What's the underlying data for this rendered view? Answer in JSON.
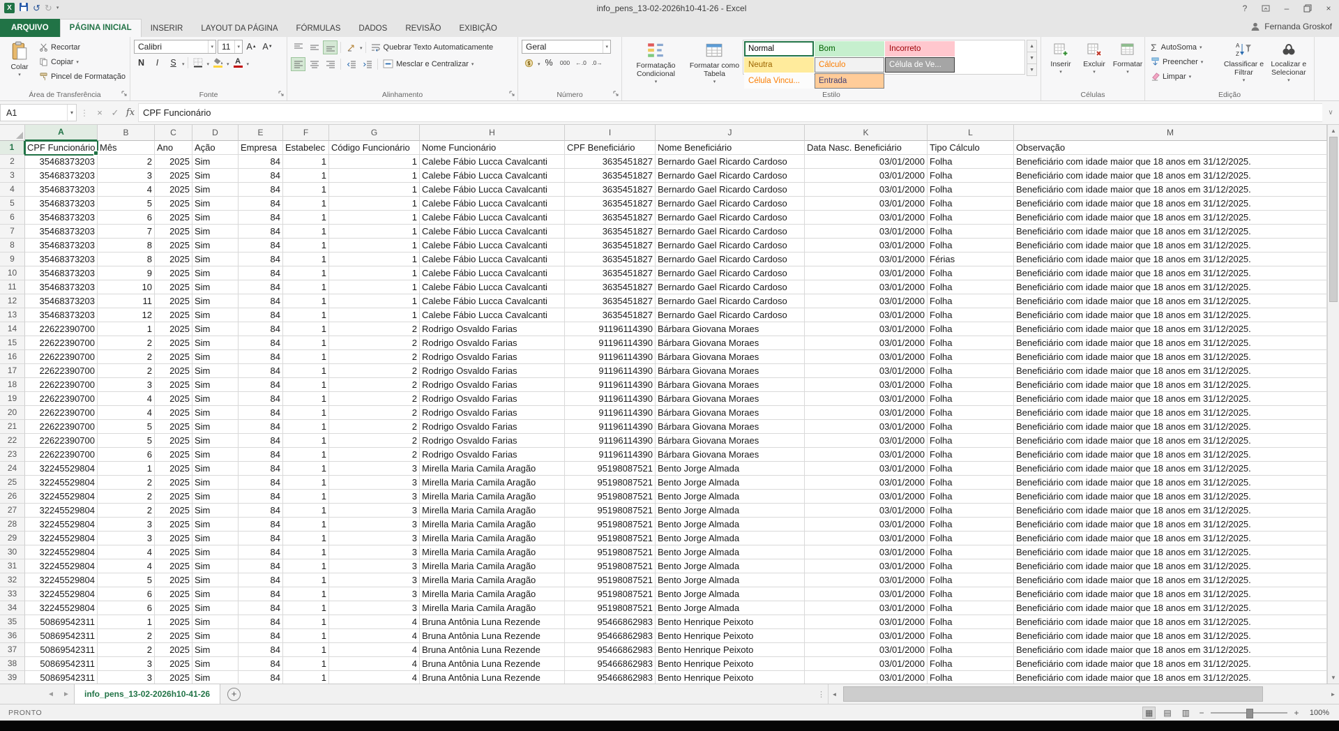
{
  "window": {
    "title": "info_pens_13-02-2026h10-41-26 - Excel",
    "user": "Fernanda Groskof",
    "accent": "#217346"
  },
  "icons": {
    "app": "X",
    "undo": "↺",
    "redo": "↻",
    "qat_caret": "▾",
    "help": "?",
    "minimize": "–",
    "close": "×",
    "cancel": "×",
    "enter": "✓",
    "fx": "fx",
    "formula_expand": "∨",
    "autosum": "Σ",
    "percent": "%",
    "thousands": "000",
    "increase_decimal": "←.0",
    "decrease_decimal": ".0→",
    "bold": "N",
    "italic": "I",
    "underline": "S",
    "sheet_prev": "◄",
    "sheet_next": "►",
    "new_sheet": "+",
    "splitter": "⋮",
    "scroll_left": "◄",
    "scroll_right": "►",
    "scroll_up": "▲",
    "scroll_down": "▼",
    "view_normal": "▦",
    "view_layout": "▤",
    "view_break": "▥",
    "zoom_out": "−",
    "zoom_in": "+"
  },
  "ribbon": {
    "tabs": [
      {
        "label": "ARQUIVO",
        "file": true
      },
      {
        "label": "PÁGINA INICIAL",
        "active": true
      },
      {
        "label": "INSERIR"
      },
      {
        "label": "LAYOUT DA PÁGINA"
      },
      {
        "label": "FÓRMULAS"
      },
      {
        "label": "DADOS"
      },
      {
        "label": "REVISÃO"
      },
      {
        "label": "EXIBIÇÃO"
      }
    ],
    "clipboard": {
      "label": "Área de Transferência",
      "paste": "Colar",
      "cut": "Recortar",
      "copy": "Copiar",
      "painter": "Pincel de Formatação"
    },
    "font": {
      "label": "Fonte",
      "family": "Calibri",
      "size": "11"
    },
    "alignment": {
      "label": "Alinhamento",
      "wrap": "Quebrar Texto Automaticamente",
      "merge": "Mesclar e Centralizar"
    },
    "number": {
      "label": "Número",
      "format": "Geral"
    },
    "styles": {
      "label": "Estilo",
      "conditional": "Formatação Condicional",
      "format_table": "Formatar como Tabela",
      "gallery": [
        {
          "label": "Normal",
          "bg": "#ffffff",
          "fg": "#000000",
          "selected": true
        },
        {
          "label": "Bom",
          "bg": "#c6efce",
          "fg": "#006100"
        },
        {
          "label": "Incorreto",
          "bg": "#ffc7ce",
          "fg": "#9c0006"
        },
        {
          "label": "Neutra",
          "bg": "#ffeb9c",
          "fg": "#9c6500"
        },
        {
          "label": "Cálculo",
          "bg": "#f2f2f2",
          "fg": "#fa7d00",
          "border": "#7f7f7f"
        },
        {
          "label": "Célula de Ve...",
          "bg": "#a5a5a5",
          "fg": "#ffffff",
          "border": "#3f3f3f"
        },
        {
          "label": "Célula Vincu...",
          "bg": "#fcfcfc",
          "fg": "#fa7d00"
        },
        {
          "label": "Entrada",
          "bg": "#ffcc99",
          "fg": "#3f3f76",
          "border": "#7f7f7f"
        }
      ]
    },
    "cells": {
      "label": "Células",
      "insert": "Inserir",
      "delete": "Excluir",
      "format": "Formatar"
    },
    "editing": {
      "label": "Edição",
      "autosum": "AutoSoma",
      "fill": "Preencher",
      "clear": "Limpar",
      "sort": "Classificar e Filtrar",
      "find": "Localizar e Selecionar"
    }
  },
  "formula": {
    "cell_ref": "A1",
    "content": "CPF Funcionário"
  },
  "sheet": {
    "tab_name": "info_pens_13-02-2026h10-41-26",
    "columns": [
      "A",
      "B",
      "C",
      "D",
      "E",
      "F",
      "G",
      "H",
      "I",
      "J",
      "K",
      "L",
      "M"
    ],
    "rows": [
      [
        "CPF Funcionário",
        "Mês",
        "Ano",
        "Ação",
        "Empresa",
        "Estabelec",
        "Código Funcionário",
        "Nome Funcionário",
        "CPF Beneficiário",
        "Nome Beneficiário",
        "Data Nasc. Beneficiário",
        "Tipo Cálculo",
        "Observação"
      ],
      [
        "35468373203",
        "2",
        "2025",
        "Sim",
        "84",
        "1",
        "1",
        "Calebe Fábio Lucca Cavalcanti",
        "3635451827",
        "Bernardo Gael Ricardo Cardoso",
        "03/01/2000",
        "Folha",
        "Beneficiário com idade maior que 18 anos em 31/12/2025."
      ],
      [
        "35468373203",
        "3",
        "2025",
        "Sim",
        "84",
        "1",
        "1",
        "Calebe Fábio Lucca Cavalcanti",
        "3635451827",
        "Bernardo Gael Ricardo Cardoso",
        "03/01/2000",
        "Folha",
        "Beneficiário com idade maior que 18 anos em 31/12/2025."
      ],
      [
        "35468373203",
        "4",
        "2025",
        "Sim",
        "84",
        "1",
        "1",
        "Calebe Fábio Lucca Cavalcanti",
        "3635451827",
        "Bernardo Gael Ricardo Cardoso",
        "03/01/2000",
        "Folha",
        "Beneficiário com idade maior que 18 anos em 31/12/2025."
      ],
      [
        "35468373203",
        "5",
        "2025",
        "Sim",
        "84",
        "1",
        "1",
        "Calebe Fábio Lucca Cavalcanti",
        "3635451827",
        "Bernardo Gael Ricardo Cardoso",
        "03/01/2000",
        "Folha",
        "Beneficiário com idade maior que 18 anos em 31/12/2025."
      ],
      [
        "35468373203",
        "6",
        "2025",
        "Sim",
        "84",
        "1",
        "1",
        "Calebe Fábio Lucca Cavalcanti",
        "3635451827",
        "Bernardo Gael Ricardo Cardoso",
        "03/01/2000",
        "Folha",
        "Beneficiário com idade maior que 18 anos em 31/12/2025."
      ],
      [
        "35468373203",
        "7",
        "2025",
        "Sim",
        "84",
        "1",
        "1",
        "Calebe Fábio Lucca Cavalcanti",
        "3635451827",
        "Bernardo Gael Ricardo Cardoso",
        "03/01/2000",
        "Folha",
        "Beneficiário com idade maior que 18 anos em 31/12/2025."
      ],
      [
        "35468373203",
        "8",
        "2025",
        "Sim",
        "84",
        "1",
        "1",
        "Calebe Fábio Lucca Cavalcanti",
        "3635451827",
        "Bernardo Gael Ricardo Cardoso",
        "03/01/2000",
        "Folha",
        "Beneficiário com idade maior que 18 anos em 31/12/2025."
      ],
      [
        "35468373203",
        "8",
        "2025",
        "Sim",
        "84",
        "1",
        "1",
        "Calebe Fábio Lucca Cavalcanti",
        "3635451827",
        "Bernardo Gael Ricardo Cardoso",
        "03/01/2000",
        "Férias",
        "Beneficiário com idade maior que 18 anos em 31/12/2025."
      ],
      [
        "35468373203",
        "9",
        "2025",
        "Sim",
        "84",
        "1",
        "1",
        "Calebe Fábio Lucca Cavalcanti",
        "3635451827",
        "Bernardo Gael Ricardo Cardoso",
        "03/01/2000",
        "Folha",
        "Beneficiário com idade maior que 18 anos em 31/12/2025."
      ],
      [
        "35468373203",
        "10",
        "2025",
        "Sim",
        "84",
        "1",
        "1",
        "Calebe Fábio Lucca Cavalcanti",
        "3635451827",
        "Bernardo Gael Ricardo Cardoso",
        "03/01/2000",
        "Folha",
        "Beneficiário com idade maior que 18 anos em 31/12/2025."
      ],
      [
        "35468373203",
        "11",
        "2025",
        "Sim",
        "84",
        "1",
        "1",
        "Calebe Fábio Lucca Cavalcanti",
        "3635451827",
        "Bernardo Gael Ricardo Cardoso",
        "03/01/2000",
        "Folha",
        "Beneficiário com idade maior que 18 anos em 31/12/2025."
      ],
      [
        "35468373203",
        "12",
        "2025",
        "Sim",
        "84",
        "1",
        "1",
        "Calebe Fábio Lucca Cavalcanti",
        "3635451827",
        "Bernardo Gael Ricardo Cardoso",
        "03/01/2000",
        "Folha",
        "Beneficiário com idade maior que 18 anos em 31/12/2025."
      ],
      [
        "22622390700",
        "1",
        "2025",
        "Sim",
        "84",
        "1",
        "2",
        "Rodrigo Osvaldo Farias",
        "91196114390",
        "Bárbara Giovana Moraes",
        "03/01/2000",
        "Folha",
        "Beneficiário com idade maior que 18 anos em 31/12/2025."
      ],
      [
        "22622390700",
        "2",
        "2025",
        "Sim",
        "84",
        "1",
        "2",
        "Rodrigo Osvaldo Farias",
        "91196114390",
        "Bárbara Giovana Moraes",
        "03/01/2000",
        "Folha",
        "Beneficiário com idade maior que 18 anos em 31/12/2025."
      ],
      [
        "22622390700",
        "2",
        "2025",
        "Sim",
        "84",
        "1",
        "2",
        "Rodrigo Osvaldo Farias",
        "91196114390",
        "Bárbara Giovana Moraes",
        "03/01/2000",
        "Folha",
        "Beneficiário com idade maior que 18 anos em 31/12/2025."
      ],
      [
        "22622390700",
        "2",
        "2025",
        "Sim",
        "84",
        "1",
        "2",
        "Rodrigo Osvaldo Farias",
        "91196114390",
        "Bárbara Giovana Moraes",
        "03/01/2000",
        "Folha",
        "Beneficiário com idade maior que 18 anos em 31/12/2025."
      ],
      [
        "22622390700",
        "3",
        "2025",
        "Sim",
        "84",
        "1",
        "2",
        "Rodrigo Osvaldo Farias",
        "91196114390",
        "Bárbara Giovana Moraes",
        "03/01/2000",
        "Folha",
        "Beneficiário com idade maior que 18 anos em 31/12/2025."
      ],
      [
        "22622390700",
        "4",
        "2025",
        "Sim",
        "84",
        "1",
        "2",
        "Rodrigo Osvaldo Farias",
        "91196114390",
        "Bárbara Giovana Moraes",
        "03/01/2000",
        "Folha",
        "Beneficiário com idade maior que 18 anos em 31/12/2025."
      ],
      [
        "22622390700",
        "4",
        "2025",
        "Sim",
        "84",
        "1",
        "2",
        "Rodrigo Osvaldo Farias",
        "91196114390",
        "Bárbara Giovana Moraes",
        "03/01/2000",
        "Folha",
        "Beneficiário com idade maior que 18 anos em 31/12/2025."
      ],
      [
        "22622390700",
        "5",
        "2025",
        "Sim",
        "84",
        "1",
        "2",
        "Rodrigo Osvaldo Farias",
        "91196114390",
        "Bárbara Giovana Moraes",
        "03/01/2000",
        "Folha",
        "Beneficiário com idade maior que 18 anos em 31/12/2025."
      ],
      [
        "22622390700",
        "5",
        "2025",
        "Sim",
        "84",
        "1",
        "2",
        "Rodrigo Osvaldo Farias",
        "91196114390",
        "Bárbara Giovana Moraes",
        "03/01/2000",
        "Folha",
        "Beneficiário com idade maior que 18 anos em 31/12/2025."
      ],
      [
        "22622390700",
        "6",
        "2025",
        "Sim",
        "84",
        "1",
        "2",
        "Rodrigo Osvaldo Farias",
        "91196114390",
        "Bárbara Giovana Moraes",
        "03/01/2000",
        "Folha",
        "Beneficiário com idade maior que 18 anos em 31/12/2025."
      ],
      [
        "32245529804",
        "1",
        "2025",
        "Sim",
        "84",
        "1",
        "3",
        "Mirella Maria Camila Aragão",
        "95198087521",
        "Bento Jorge Almada",
        "03/01/2000",
        "Folha",
        "Beneficiário com idade maior que 18 anos em 31/12/2025."
      ],
      [
        "32245529804",
        "2",
        "2025",
        "Sim",
        "84",
        "1",
        "3",
        "Mirella Maria Camila Aragão",
        "95198087521",
        "Bento Jorge Almada",
        "03/01/2000",
        "Folha",
        "Beneficiário com idade maior que 18 anos em 31/12/2025."
      ],
      [
        "32245529804",
        "2",
        "2025",
        "Sim",
        "84",
        "1",
        "3",
        "Mirella Maria Camila Aragão",
        "95198087521",
        "Bento Jorge Almada",
        "03/01/2000",
        "Folha",
        "Beneficiário com idade maior que 18 anos em 31/12/2025."
      ],
      [
        "32245529804",
        "2",
        "2025",
        "Sim",
        "84",
        "1",
        "3",
        "Mirella Maria Camila Aragão",
        "95198087521",
        "Bento Jorge Almada",
        "03/01/2000",
        "Folha",
        "Beneficiário com idade maior que 18 anos em 31/12/2025."
      ],
      [
        "32245529804",
        "3",
        "2025",
        "Sim",
        "84",
        "1",
        "3",
        "Mirella Maria Camila Aragão",
        "95198087521",
        "Bento Jorge Almada",
        "03/01/2000",
        "Folha",
        "Beneficiário com idade maior que 18 anos em 31/12/2025."
      ],
      [
        "32245529804",
        "3",
        "2025",
        "Sim",
        "84",
        "1",
        "3",
        "Mirella Maria Camila Aragão",
        "95198087521",
        "Bento Jorge Almada",
        "03/01/2000",
        "Folha",
        "Beneficiário com idade maior que 18 anos em 31/12/2025."
      ],
      [
        "32245529804",
        "4",
        "2025",
        "Sim",
        "84",
        "1",
        "3",
        "Mirella Maria Camila Aragão",
        "95198087521",
        "Bento Jorge Almada",
        "03/01/2000",
        "Folha",
        "Beneficiário com idade maior que 18 anos em 31/12/2025."
      ],
      [
        "32245529804",
        "4",
        "2025",
        "Sim",
        "84",
        "1",
        "3",
        "Mirella Maria Camila Aragão",
        "95198087521",
        "Bento Jorge Almada",
        "03/01/2000",
        "Folha",
        "Beneficiário com idade maior que 18 anos em 31/12/2025."
      ],
      [
        "32245529804",
        "5",
        "2025",
        "Sim",
        "84",
        "1",
        "3",
        "Mirella Maria Camila Aragão",
        "95198087521",
        "Bento Jorge Almada",
        "03/01/2000",
        "Folha",
        "Beneficiário com idade maior que 18 anos em 31/12/2025."
      ],
      [
        "32245529804",
        "6",
        "2025",
        "Sim",
        "84",
        "1",
        "3",
        "Mirella Maria Camila Aragão",
        "95198087521",
        "Bento Jorge Almada",
        "03/01/2000",
        "Folha",
        "Beneficiário com idade maior que 18 anos em 31/12/2025."
      ],
      [
        "32245529804",
        "6",
        "2025",
        "Sim",
        "84",
        "1",
        "3",
        "Mirella Maria Camila Aragão",
        "95198087521",
        "Bento Jorge Almada",
        "03/01/2000",
        "Folha",
        "Beneficiário com idade maior que 18 anos em 31/12/2025."
      ],
      [
        "50869542311",
        "1",
        "2025",
        "Sim",
        "84",
        "1",
        "4",
        "Bruna Antônia Luna Rezende",
        "95466862983",
        "Bento Henrique Peixoto",
        "03/01/2000",
        "Folha",
        "Beneficiário com idade maior que 18 anos em 31/12/2025."
      ],
      [
        "50869542311",
        "2",
        "2025",
        "Sim",
        "84",
        "1",
        "4",
        "Bruna Antônia Luna Rezende",
        "95466862983",
        "Bento Henrique Peixoto",
        "03/01/2000",
        "Folha",
        "Beneficiário com idade maior que 18 anos em 31/12/2025."
      ],
      [
        "50869542311",
        "2",
        "2025",
        "Sim",
        "84",
        "1",
        "4",
        "Bruna Antônia Luna Rezende",
        "95466862983",
        "Bento Henrique Peixoto",
        "03/01/2000",
        "Folha",
        "Beneficiário com idade maior que 18 anos em 31/12/2025."
      ],
      [
        "50869542311",
        "3",
        "2025",
        "Sim",
        "84",
        "1",
        "4",
        "Bruna Antônia Luna Rezende",
        "95466862983",
        "Bento Henrique Peixoto",
        "03/01/2000",
        "Folha",
        "Beneficiário com idade maior que 18 anos em 31/12/2025."
      ],
      [
        "50869542311",
        "3",
        "2025",
        "Sim",
        "84",
        "1",
        "4",
        "Bruna Antônia Luna Rezende",
        "95466862983",
        "Bento Henrique Peixoto",
        "03/01/2000",
        "Folha",
        "Beneficiário com idade maior que 18 anos em 31/12/2025."
      ]
    ]
  },
  "status": {
    "mode": "PRONTO",
    "zoom": "100%"
  }
}
